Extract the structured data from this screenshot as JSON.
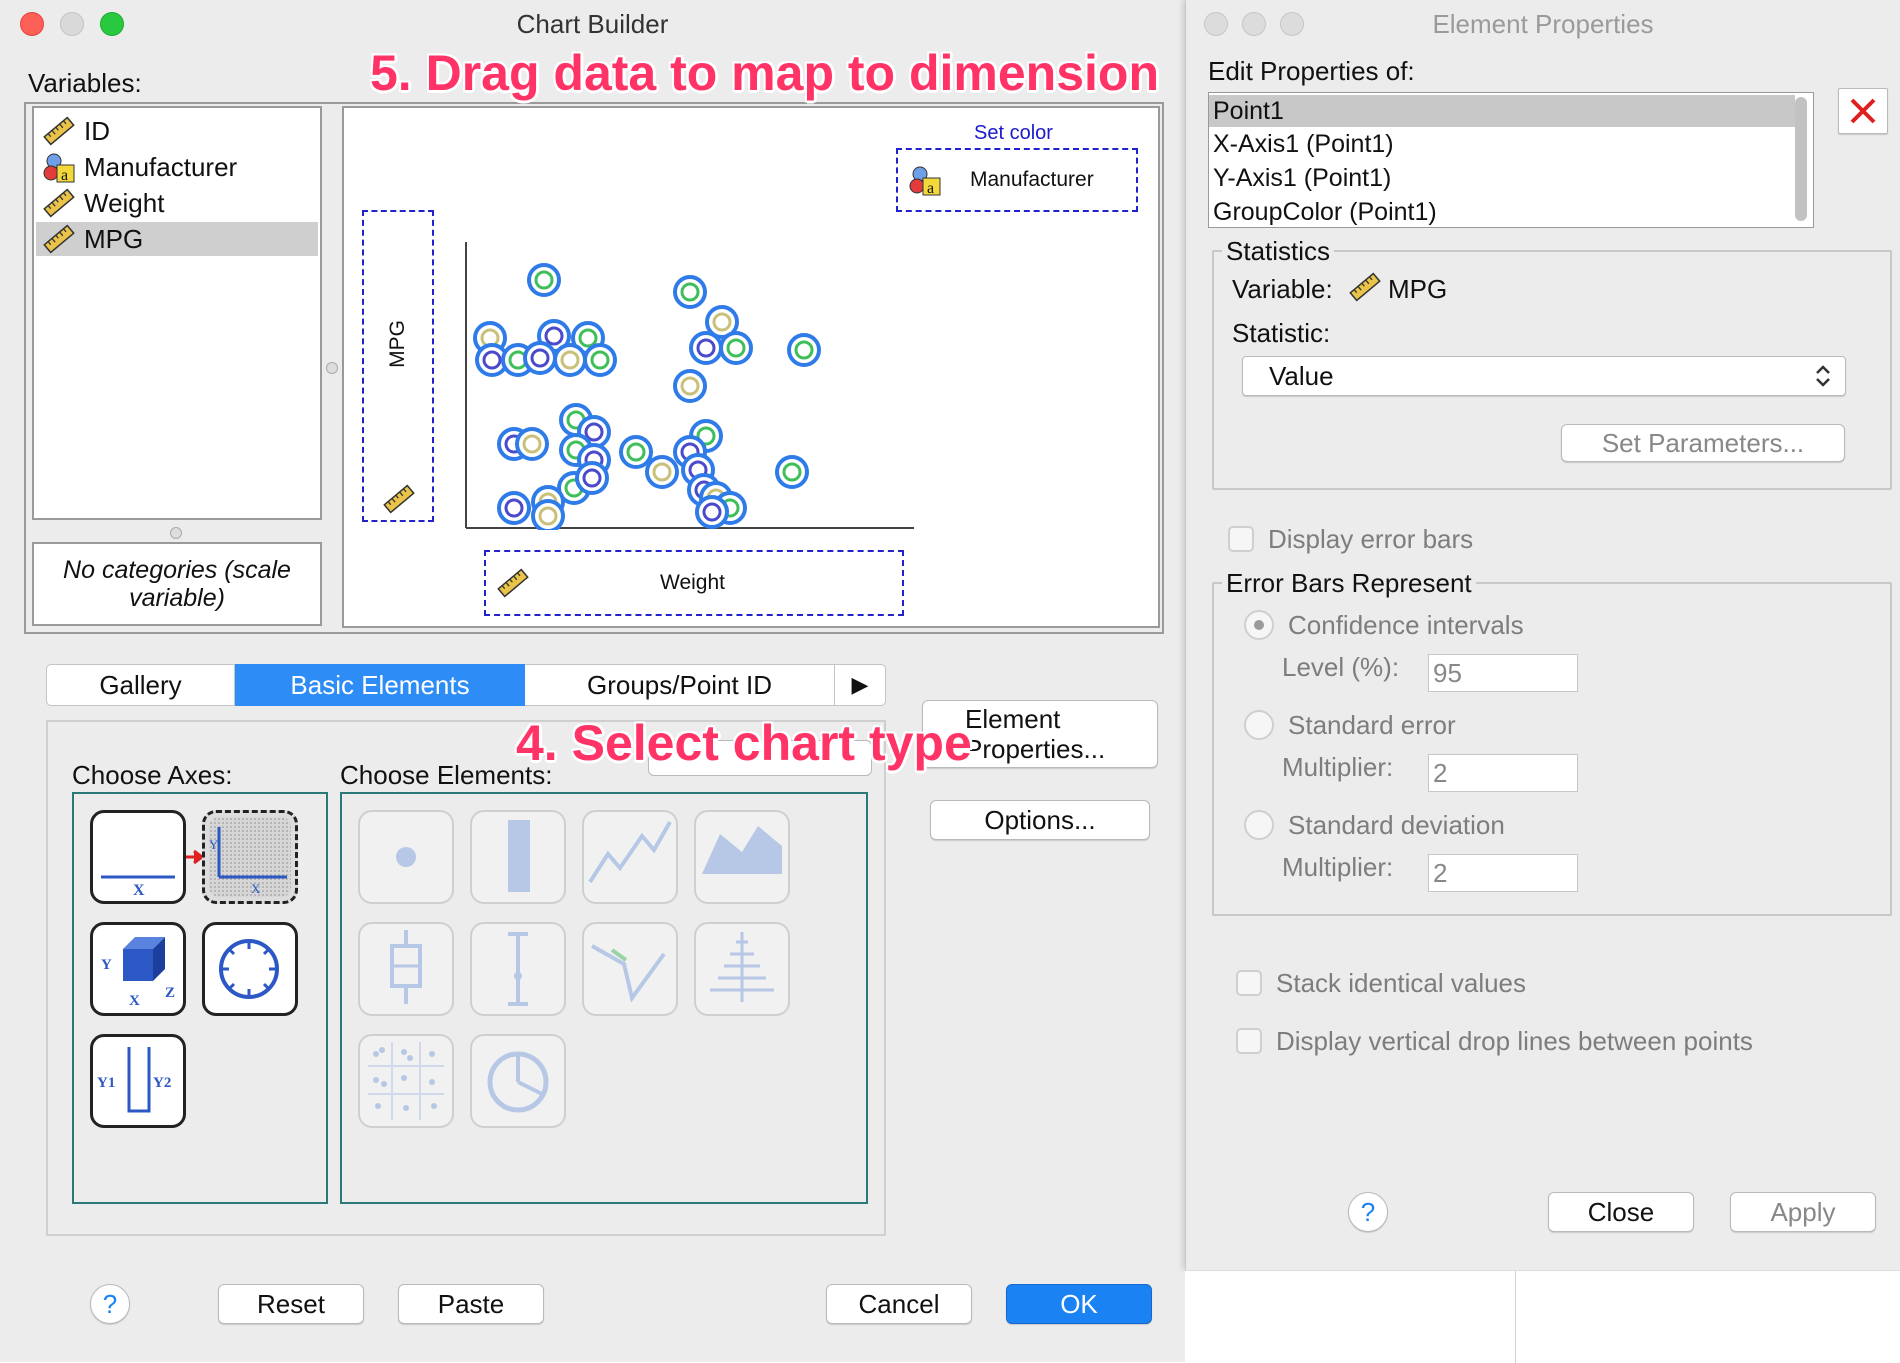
{
  "chart_builder": {
    "title": "Chart Builder",
    "variables_label": "Variables:",
    "variables": [
      {
        "name": "ID",
        "icon": "ruler-icon"
      },
      {
        "name": "Manufacturer",
        "icon": "nominal-icon"
      },
      {
        "name": "Weight",
        "icon": "ruler-icon"
      },
      {
        "name": "MPG",
        "icon": "ruler-icon",
        "selected": true
      }
    ],
    "categories_note": "No categories (scale variable)",
    "canvas": {
      "set_color_label": "Set color",
      "color_variable": "Manufacturer",
      "y_variable": "MPG",
      "x_variable": "Weight"
    },
    "tabs": [
      {
        "label": "Gallery",
        "active": false
      },
      {
        "label": "Basic Elements",
        "active": true
      },
      {
        "label": "Groups/Point ID",
        "active": false
      }
    ],
    "choose_axes_label": "Choose Axes:",
    "choose_elements_label": "Choose Elements:",
    "element_properties_button": "Element Properties...",
    "options_button": "Options...",
    "help_button": "?",
    "reset_button": "Reset",
    "paste_button": "Paste",
    "cancel_button": "Cancel",
    "ok_button": "OK",
    "axis_tile_labels": {
      "x": "X",
      "y": "Y",
      "z": "Z",
      "y1": "Y1",
      "y2": "Y2"
    }
  },
  "element_properties": {
    "title": "Element Properties",
    "edit_label": "Edit Properties of:",
    "items": [
      "Point1",
      "X-Axis1 (Point1)",
      "Y-Axis1 (Point1)",
      "GroupColor (Point1)"
    ],
    "selected_item": "Point1",
    "statistics_title": "Statistics",
    "variable_label": "Variable:",
    "variable_value": "MPG",
    "statistic_label": "Statistic:",
    "statistic_value": "Value",
    "set_parameters_button": "Set Parameters...",
    "display_error_bars": "Display error bars",
    "error_bars_title": "Error Bars Represent",
    "confidence_intervals": "Confidence intervals",
    "level_label": "Level (%):",
    "level_value": "95",
    "standard_error": "Standard error",
    "multiplier_label": "Multiplier:",
    "se_multiplier": "2",
    "standard_deviation": "Standard deviation",
    "sd_multiplier": "2",
    "stack_identical": "Stack identical values",
    "drop_lines": "Display vertical drop lines between points",
    "help_button": "?",
    "close_button": "Close",
    "apply_button": "Apply"
  },
  "annotations": {
    "step5": "5. Drag data to map to dimension",
    "step4": "4. Select chart type"
  },
  "colors": {
    "accent": "#1b82f4",
    "annotation": "#ff3366",
    "drop_zone": "#2222cc",
    "point_outer": "#2f7be8",
    "point_inner_green": "#3fbf5a",
    "point_inner_gold": "#c9c07a",
    "point_inner_blue": "#4a4acb"
  }
}
